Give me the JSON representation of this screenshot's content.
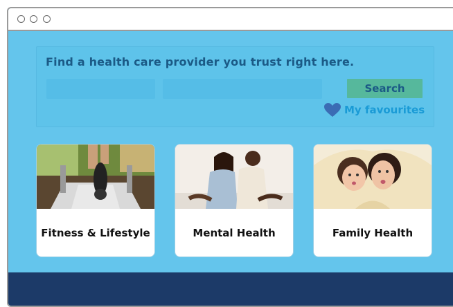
{
  "search_panel": {
    "headline": "Find a health care provider you trust right here.",
    "search_label": "Search",
    "favourites_label": "My favourites"
  },
  "categories": [
    {
      "label": "Fitness & Lifestyle"
    },
    {
      "label": "Mental Health"
    },
    {
      "label": "Family Health"
    }
  ],
  "colors": {
    "page_bg": "#64c5ec",
    "headline": "#1b5a86",
    "search_button": "#56b89c",
    "favourites_link": "#1a9bd6",
    "heart": "#3b6cb4",
    "footer": "#1c3a68"
  }
}
